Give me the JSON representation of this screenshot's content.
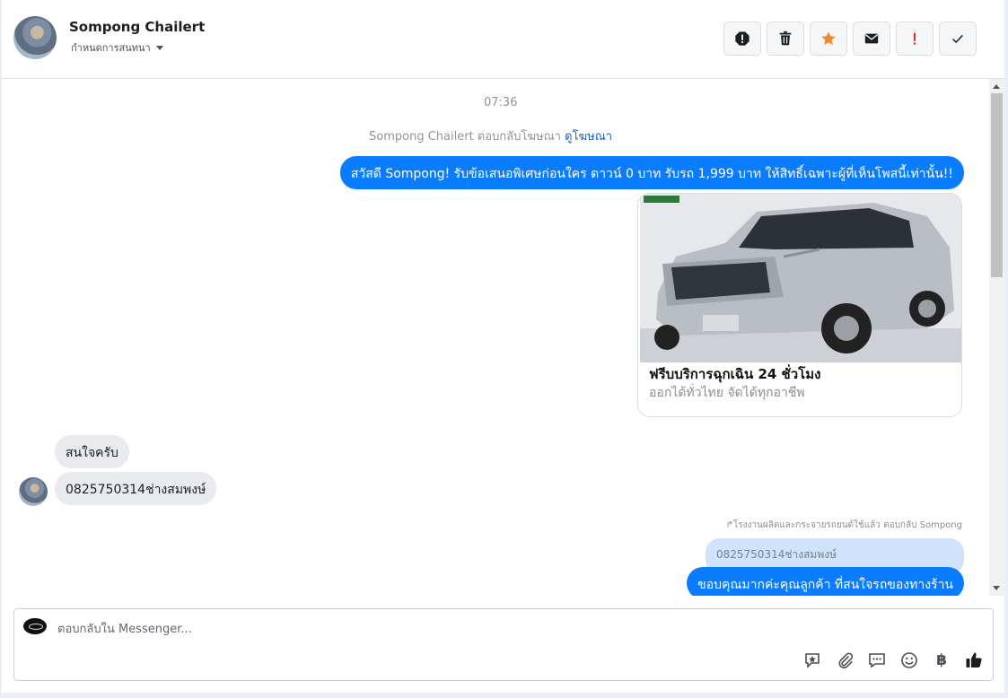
{
  "header": {
    "contact_name": "Sompong Chailert",
    "assign_label": "กำหนดการสนทนา",
    "toolbar": [
      {
        "name": "spam-icon"
      },
      {
        "name": "trash-icon"
      },
      {
        "name": "star-icon",
        "color": "#f28c28"
      },
      {
        "name": "envelope-icon"
      },
      {
        "name": "exclamation-icon",
        "color": "#d93025"
      },
      {
        "name": "checkmark-icon"
      }
    ]
  },
  "conversation": {
    "time": "07:36",
    "ad_reply_text": "Sompong Chailert ตอบกลับโฆษณา",
    "ad_reply_link": "ดูโฆษณา",
    "outgoing_greeting": "สวัสดี Sompong! รับข้อเสนอพิเศษก่อนใคร ดาวน์ 0 บาท รับรถ 1,999 บาท ให้สิทธิ์เฉพาะผู้ที่เห็นโพสนี้เท่านั้น!!",
    "ad_card": {
      "image": "silver-suv-photo",
      "title": "ฟรีบบริการฉุกเฉิน 24 ชั่วโมง",
      "subtitle": "ออกได้ทั่วไทย จัดได้ทุกอาชีพ"
    },
    "incoming": [
      "สนใจครับ",
      "0825750314ช่างสมพงษ์"
    ],
    "reply_note": "↱โรงงานผลิตและกระจายรถยนต์ใช้แล้ว ตอบกลับ Sompong",
    "quoted_message": "0825750314ช่างสมพงษ์",
    "outgoing_reply": "ขอบคุณมากค่ะคุณลูกค้า ที่สนใจรถของทางร้าน"
  },
  "composer": {
    "placeholder": "ตอบกลับใน Messenger...",
    "baht_symbol": "฿",
    "tools": [
      "saved-reply-icon",
      "attachment-icon",
      "chat-bubbles-icon",
      "emoji-icon",
      "baht-icon",
      "thumbs-up-icon"
    ]
  },
  "colors": {
    "outgoing_bubble": "#0a7cff",
    "incoming_bubble": "#e9ebee",
    "quoted_bubble": "#cfe3fc"
  }
}
